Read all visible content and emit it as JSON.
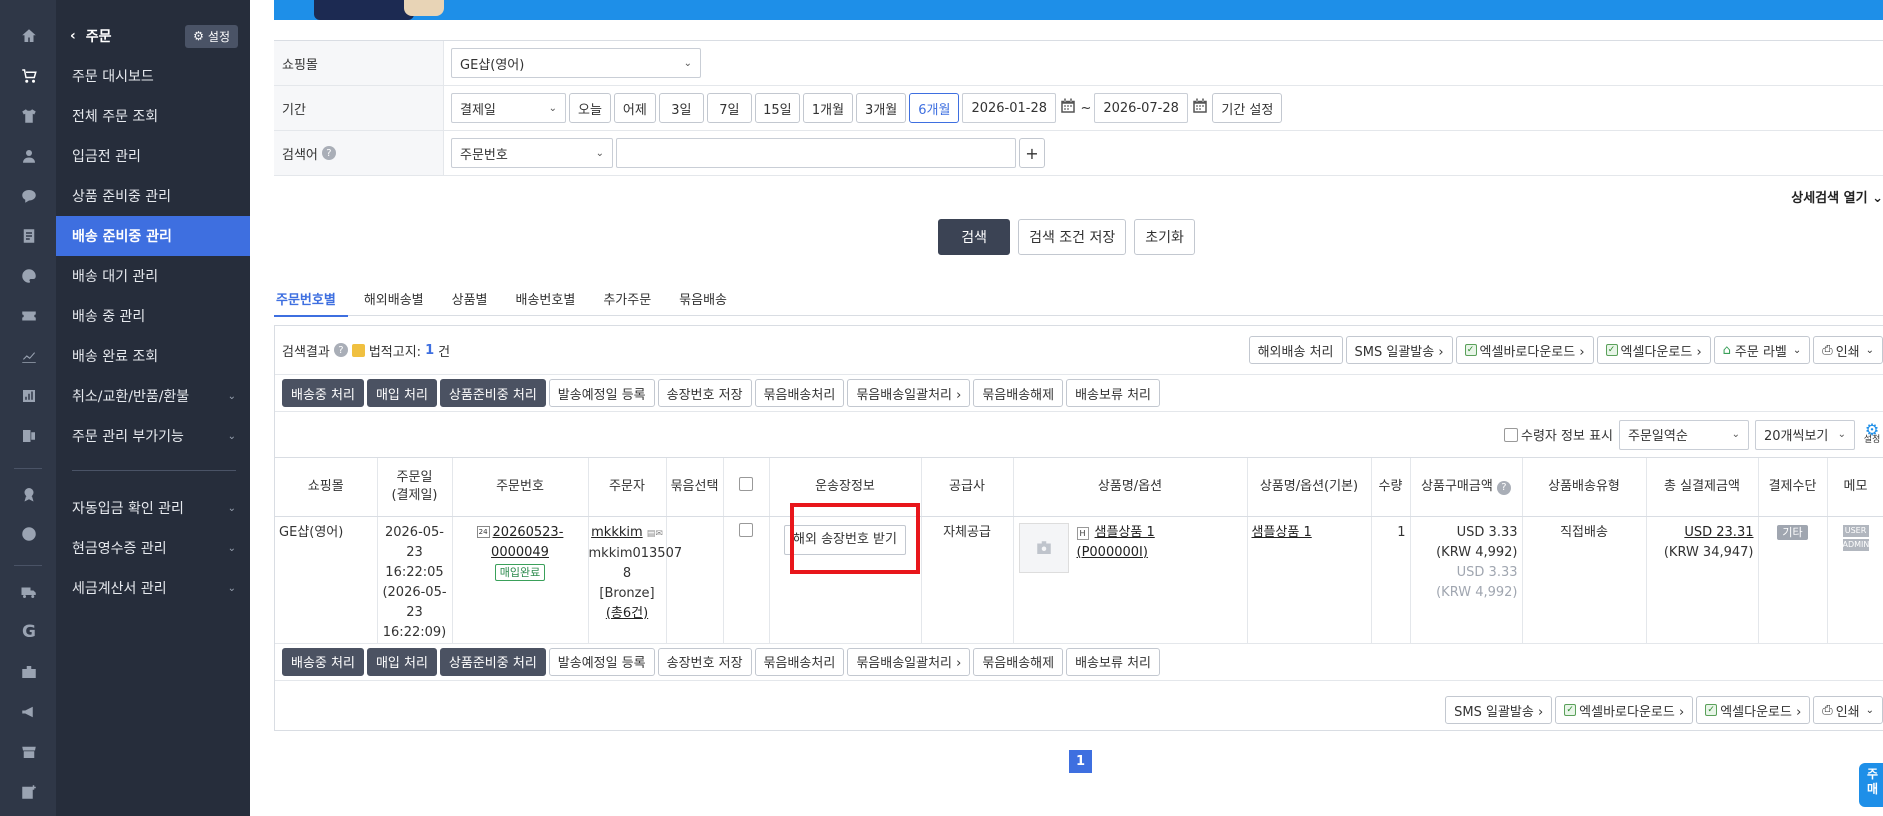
{
  "nav": {
    "title": "주문",
    "settings_label": "설정",
    "items": [
      {
        "label": "주문 대시보드"
      },
      {
        "label": "전체 주문 조회"
      },
      {
        "label": "입금전 관리"
      },
      {
        "label": "상품 준비중 관리"
      },
      {
        "label": "배송 준비중 관리"
      },
      {
        "label": "배송 대기 관리"
      },
      {
        "label": "배송 중 관리"
      },
      {
        "label": "배송 완료 조회"
      },
      {
        "label": "취소/교환/반품/환불"
      },
      {
        "label": "주문 관리 부가기능"
      },
      {
        "label": "자동입금 확인 관리"
      },
      {
        "label": "현금영수증 관리"
      },
      {
        "label": "세금계산서 관리"
      }
    ]
  },
  "rail_icons": [
    "home-icon",
    "cart-icon",
    "shirt-icon",
    "user-icon",
    "chat-icon",
    "board-icon",
    "palette-icon",
    "ticket-icon",
    "chart-icon",
    "stats-icon",
    "excel-icon",
    "badge-icon",
    "globe-icon",
    "truck-icon",
    "google-icon",
    "briefcase-icon",
    "megaphone-icon",
    "store-icon",
    "add-app-icon"
  ],
  "form": {
    "shop_label": "쇼핑몰",
    "shop_value": "GE샵(영어)",
    "period_label": "기간",
    "period_type": "결제일",
    "period_buttons": [
      "오늘",
      "어제",
      "3일",
      "7일",
      "15일",
      "1개월",
      "3개월",
      "6개월"
    ],
    "period_selected": "6개월",
    "date_from": "2026-01-28",
    "date_to": "2026-07-28",
    "tilde": "~",
    "period_set": "기간 설정",
    "keyword_label": "검색어",
    "keyword_type": "주문번호",
    "keyword_value": "",
    "add": "+"
  },
  "detail_toggle": "상세검색 열기",
  "actions": {
    "search": "검색",
    "save": "검색 조건 저장",
    "reset": "초기화"
  },
  "tabs": [
    "주문번호별",
    "해외배송별",
    "상품별",
    "배송번호별",
    "추가주문",
    "묶음배송"
  ],
  "result": {
    "label": "검색결과",
    "legal_prefix": "법적고지:",
    "count": "1",
    "count_unit": "건",
    "top_buttons": [
      "해외배송 처리",
      "SMS 일괄발송 ›",
      "엑셀바로다운로드 ›",
      "엑셀다운로드 ›",
      "주문 라벨",
      "인쇄"
    ],
    "action_buttons": [
      "배송중 처리",
      "매입 처리",
      "상품준비중 처리",
      "발송예정일 등록",
      "송장번호 저장",
      "묶음배송처리",
      "묶음배송일괄처리 ›",
      "묶음배송해제",
      "배송보류 처리"
    ],
    "receiver_info_label": "수령자 정보 표시",
    "sort_value": "주문일역순",
    "per_page_value": "20개씩보기",
    "settings_label": "설정"
  },
  "table": {
    "headers": [
      "쇼핑몰",
      "주문일\n(결제일)",
      "주문번호",
      "주문자",
      "묶음선택",
      "",
      "운송장정보",
      "공급사",
      "상품명/옵션",
      "상품명/옵션(기본)",
      "수량",
      "상품구매금액",
      "상품배송유형",
      "총 실결제금액",
      "결제수단",
      "메모"
    ],
    "row": {
      "shop": "GE샵(영어)",
      "order_date_1": "2026-05-",
      "order_date_2": "23",
      "order_date_3": "16:22:05",
      "order_date_4": "(2026-05-",
      "order_date_5": "23",
      "order_date_6": "16:22:09)",
      "order_no_icon": "24",
      "order_no_1": "20260523-",
      "order_no_2": "0000049",
      "order_badge": "매입완료",
      "orderer_id": "mkkkim",
      "orderer_sub_1": "mkkim013507",
      "orderer_sub_2": "8",
      "orderer_grade": "[Bronze]",
      "orderer_count": "(총6건)",
      "tracking_button": "해외 송장번호 받기",
      "supplier": "자체공급",
      "product_badge": "H",
      "product_name": "샘플상품 1",
      "product_code": "(P000000I)",
      "product_base": "샘플상품 1",
      "qty": "1",
      "price_1": "USD 3.33",
      "price_2": "(KRW 4,992)",
      "price_3": "USD 3.33",
      "price_4": "(KRW 4,992)",
      "ship_type": "직접배송",
      "total_1": "USD 23.31",
      "total_2": "(KRW 34,947)",
      "pay_method": "기타",
      "memo_tags": [
        "USER",
        "ADMIN"
      ]
    }
  },
  "bottom_buttons": [
    "SMS 일괄발송 ›",
    "엑셀바로다운로드 ›",
    "엑셀다운로드 ›",
    "인쇄"
  ],
  "pager_current": "1",
  "float_label_1": "주",
  "float_label_2": "매"
}
